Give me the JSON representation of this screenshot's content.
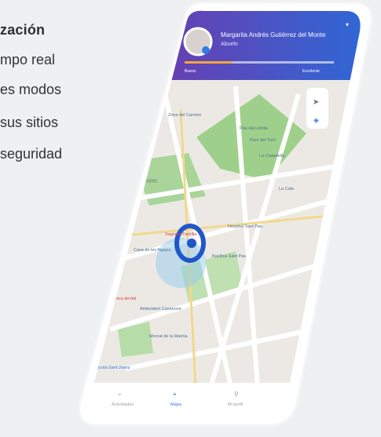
{
  "hero": {
    "title": "zación",
    "lines": [
      "mpo real",
      "es modos",
      "sus sitios",
      "seguridad"
    ]
  },
  "app": {
    "header": {
      "name": "Margarita Andrés Gutiérrez del Monte",
      "sub": "Abuelo",
      "progress_label_left": "Bueno",
      "progress_label_right": "Excelente",
      "progress_value": 0.32,
      "gradient_start": "#6b3db0",
      "gradient_end": "#2b6ad8"
    },
    "map": {
      "places": [
        "Zona del Carmen",
        "Pau del Lérida",
        "Parc del Turó",
        "La Ciutadella",
        "GAN PARK",
        "La Cala",
        "Hospital Sant Pau",
        "Casa de les Aigües",
        "Sagrada Família",
        "Basílica Sant Pau",
        "Clínica dental",
        "Ambulatori Casanova",
        "Mercat de la Marina",
        "Escola Sant Josep"
      ],
      "location_accent": "#1f57c9"
    },
    "nav": {
      "items": [
        "Actividades",
        "Mapa",
        "Mi perfil"
      ],
      "active_index": 1,
      "active_color": "#2f7be6"
    }
  }
}
